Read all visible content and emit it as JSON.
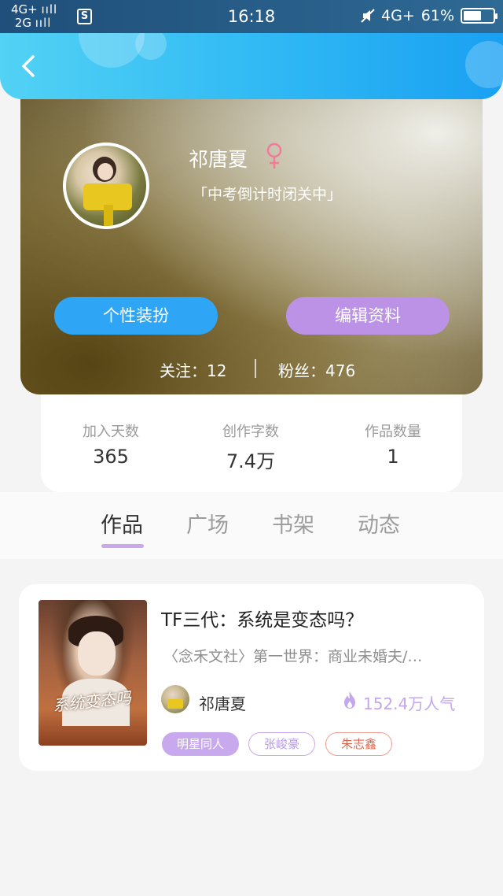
{
  "status_bar": {
    "network_top": "4G+",
    "network_bottom": "2G",
    "sim_badge": "S",
    "time": "16:18",
    "network_right": "4G+",
    "battery": "61%",
    "battery_level": 0.61
  },
  "header": {
    "back_icon": "chevron-left-icon"
  },
  "profile": {
    "username": "祁唐夏",
    "gender_icon": "female-icon",
    "bio": "「中考倒计时闭关中」",
    "dress_button": "个性装扮",
    "edit_button": "编辑资料",
    "following_label": "关注：12",
    "followers_label": "粉丝：476"
  },
  "stats": [
    {
      "label": "加入天数",
      "value": "365"
    },
    {
      "label": "创作字数",
      "value": "7.4万"
    },
    {
      "label": "作品数量",
      "value": "1"
    }
  ],
  "tabs": [
    {
      "label": "作品",
      "active": true
    },
    {
      "label": "广场",
      "active": false
    },
    {
      "label": "书架",
      "active": false
    },
    {
      "label": "动态",
      "active": false
    }
  ],
  "work": {
    "cover_text": "系统变态吗",
    "title": "TF三代：系统是变态吗？",
    "description": "〈念禾文社〉第一世界：商业未婚夫/…",
    "author": "祁唐夏",
    "popularity": "152.4万人气",
    "popularity_icon": "fire-icon",
    "tags": [
      "明星同人",
      "张峻豪",
      "朱志鑫"
    ]
  },
  "colors": {
    "header_blue": "#2fb8f4",
    "dress_button": "#2ea6f5",
    "edit_button": "#bb92e6",
    "accent_purple": "#c9a9ee",
    "tag_red": "#e0664a"
  }
}
